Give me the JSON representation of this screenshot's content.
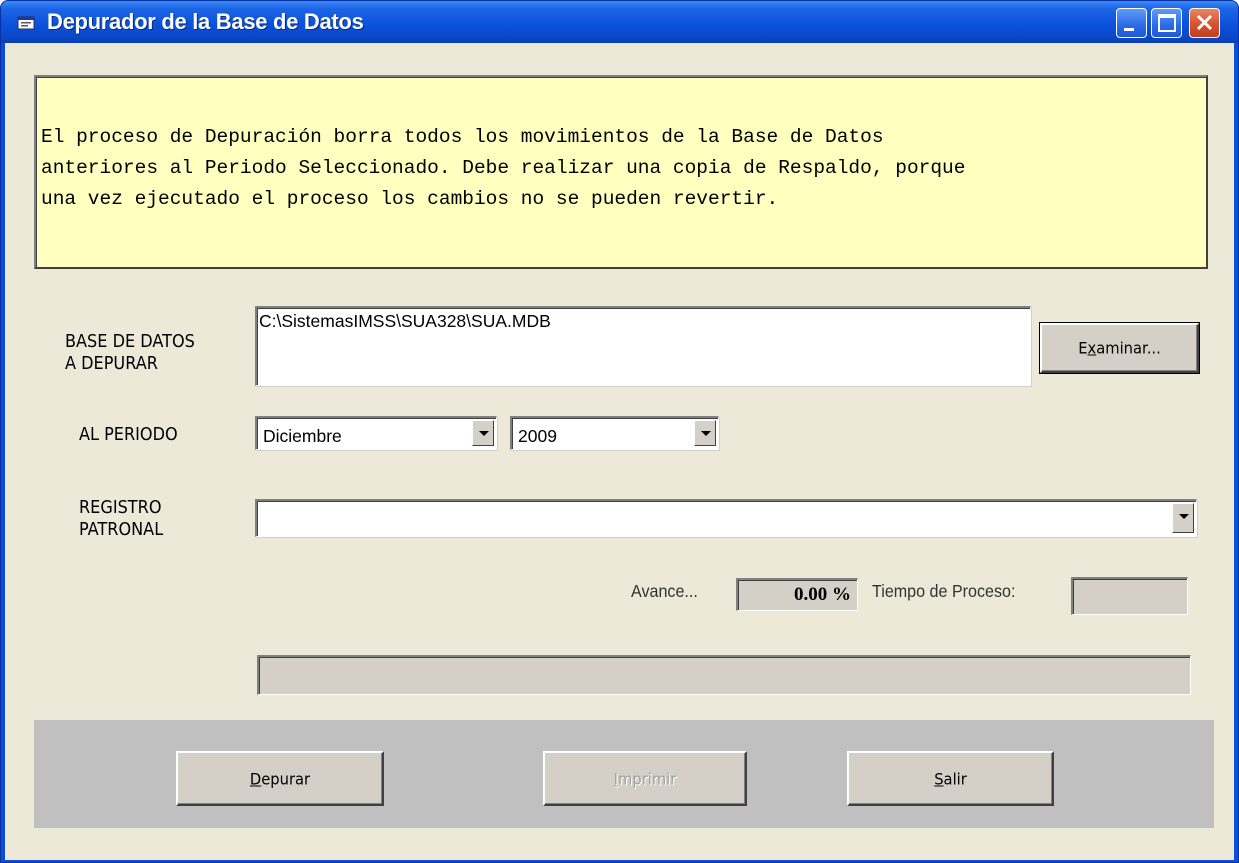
{
  "window": {
    "title": "Depurador de la Base de Datos"
  },
  "info": {
    "message": "El proceso de Depuración borra todos los movimientos de la Base de Datos\nanteriores al Periodo Seleccionado. Debe realizar una copia de Respaldo, porque\nuna vez ejecutado el proceso los cambios no se pueden revertir.",
    "background_color": "#ffffc0"
  },
  "database": {
    "label_line1": "BASE DE DATOS",
    "label_line2": "A DEPURAR",
    "path": "C:\\SistemasIMSS\\SUA328\\SUA.MDB",
    "browse_button": {
      "before": "E",
      "accel": "x",
      "after": "aminar..."
    }
  },
  "period": {
    "label": "AL PERIODO",
    "month": "Diciembre",
    "year": "2009"
  },
  "registro": {
    "label_line1": "REGISTRO",
    "label_line2": "PATRONAL",
    "value": ""
  },
  "progress": {
    "avance_label": "Avance...",
    "avance_value": "0.00 %",
    "tiempo_label": "Tiempo de Proceso:",
    "tiempo_value": "",
    "fraction": 0
  },
  "buttons": {
    "depurar": {
      "accel": "D",
      "rest": "epurar"
    },
    "imprimir": {
      "accel": "I",
      "rest": "mprimir"
    },
    "salir": {
      "accel": "S",
      "rest": "alir"
    }
  },
  "icons": [
    "app-icon",
    "minimize-icon",
    "maximize-icon",
    "close-icon",
    "dropdown-arrow-icon"
  ],
  "colors": {
    "titlebar": "#0a52dc",
    "client_background": "#ece9d8",
    "bottom_panel": "#c0c0c0",
    "close_button": "#d4522e"
  }
}
